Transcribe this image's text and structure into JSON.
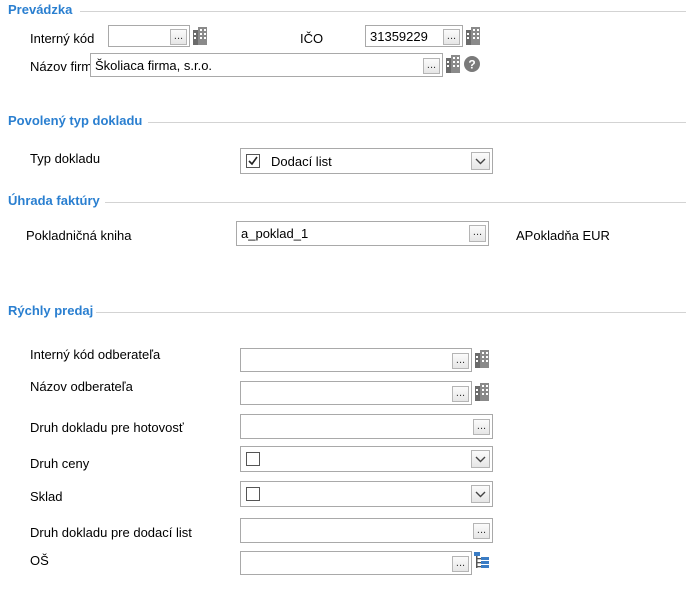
{
  "sections": {
    "prevadzka": "Prevádzka",
    "povoleny_typ": "Povolený typ dokladu",
    "uhrada": "Úhrada faktúry",
    "rychly_predaj": "Rýchly predaj"
  },
  "prevadzka": {
    "interny_kod_label": "Interný kód",
    "interny_kod_value": "",
    "ico_label": "IČO",
    "ico_value": "31359229",
    "nazov_label": "Názov firmy",
    "nazov_value": "Školiaca firma, s.r.o."
  },
  "typ_dokladu": {
    "label": "Typ dokladu",
    "value": "Dodací list",
    "checked": true
  },
  "uhrada": {
    "kniha_label": "Pokladničná kniha",
    "kniha_value": "a_poklad_1",
    "kniha_desc": "APokladňa EUR"
  },
  "rychly_predaj": {
    "interny_kod_odb_label": "Interný kód odberateľa",
    "nazov_odb_label": "Názov odberateľa",
    "druh_hotovost_label": "Druh dokladu pre hotovosť",
    "druh_ceny_label": "Druh ceny",
    "sklad_label": "Sklad",
    "druh_dodaci_label": "Druh dokladu pre dodací list",
    "os_label": "OŠ"
  },
  "buttons": {
    "browse": "..."
  },
  "icons": {
    "building": "building-icon",
    "help": "help-icon",
    "tree": "tree-icon",
    "dropdown": "chevron-down-icon",
    "checkbox": "checkbox"
  },
  "colors": {
    "section_title": "#2a7fd0",
    "border": "#a9a9a9"
  }
}
